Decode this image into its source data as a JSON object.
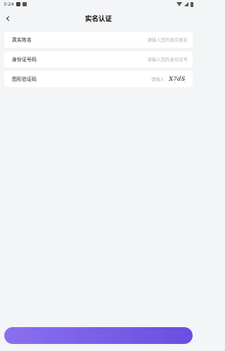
{
  "status_bar": {
    "time": "3:24",
    "icons": [
      "notification-icon",
      "notification-icon",
      "wifi-icon",
      "signal-icon",
      "battery-icon"
    ]
  },
  "nav": {
    "title": "实名认证",
    "back_icon": "chevron-left-icon"
  },
  "form": {
    "name": {
      "label": "真实姓名",
      "placeholder": "请输入您的真实姓名",
      "value": ""
    },
    "id_number": {
      "label": "身份证号码",
      "placeholder": "请输入您的身份证号",
      "value": ""
    },
    "captcha": {
      "label": "图形验证码",
      "placeholder": "请输入",
      "value": "",
      "image_text": "X7dS"
    }
  },
  "colors": {
    "background": "#f4f5f7",
    "row_background": "#ffffff",
    "button_gradient_start": "#8a70ef",
    "button_gradient_end": "#6a4ee0",
    "placeholder": "#b3b3b3"
  }
}
